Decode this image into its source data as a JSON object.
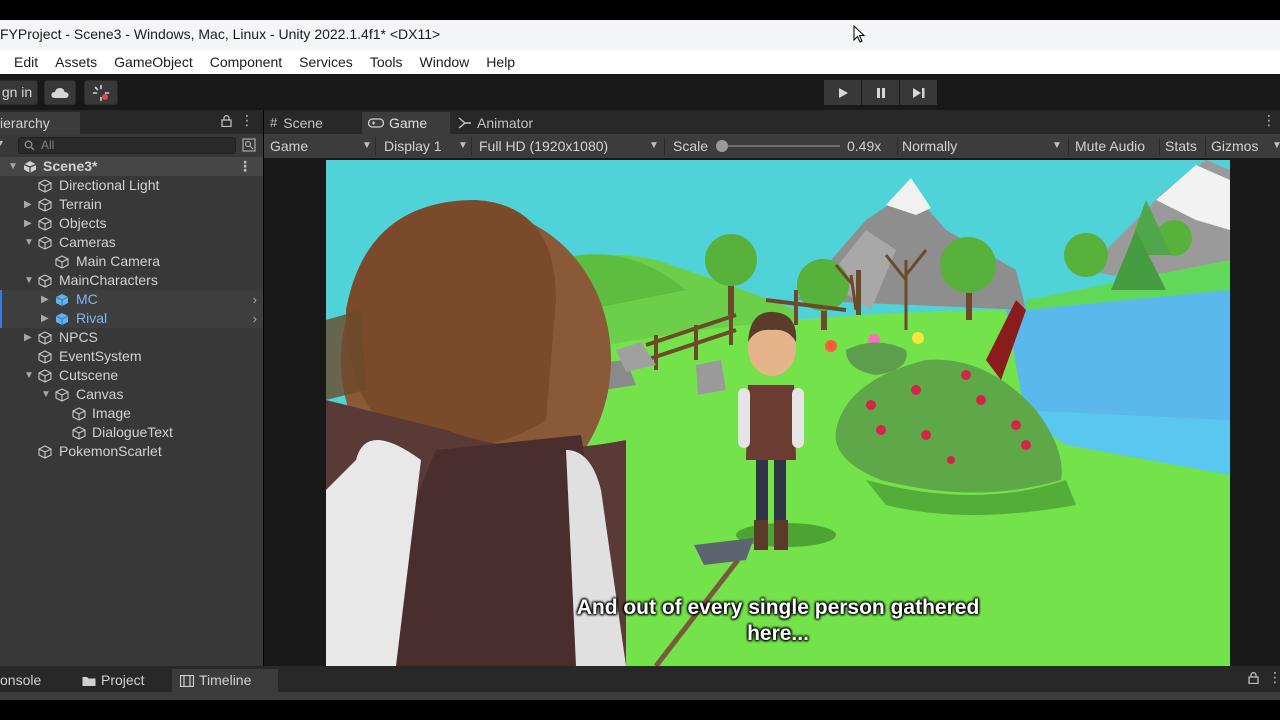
{
  "window": {
    "title": "FYProject - Scene3 - Windows, Mac, Linux - Unity 2022.1.4f1* <DX11>"
  },
  "menu": [
    "Edit",
    "Assets",
    "GameObject",
    "Component",
    "Services",
    "Tools",
    "Window",
    "Help"
  ],
  "toolbar": {
    "sign_in_label": "gn in"
  },
  "hierarchy": {
    "tab_label": "ierarchy",
    "search_placeholder": "All",
    "scene_name": "Scene3*",
    "items": [
      {
        "label": "Directional Light"
      },
      {
        "label": "Terrain"
      },
      {
        "label": "Objects"
      },
      {
        "label": "Cameras"
      },
      {
        "label": "Main Camera"
      },
      {
        "label": "MainCharacters"
      },
      {
        "label": "MC"
      },
      {
        "label": "Rival"
      },
      {
        "label": "NPCS"
      },
      {
        "label": "EventSystem"
      },
      {
        "label": "Cutscene"
      },
      {
        "label": "Canvas"
      },
      {
        "label": "Image"
      },
      {
        "label": "DialogueText"
      },
      {
        "label": "PokemonScarlet"
      }
    ]
  },
  "game_view": {
    "tabs": [
      "Scene",
      "Game",
      "Animator"
    ],
    "active_tab": "Game",
    "view_mode": "Game",
    "display": "Display 1",
    "resolution": "Full HD (1920x1080)",
    "scale_label": "Scale",
    "scale_value": "0.49x",
    "scale_fraction": 0.0,
    "play_focus": "Normally",
    "mute_audio": "Mute Audio",
    "stats": "Stats",
    "gizmos": "Gizmos",
    "subtitle_line1": "And out of every single person gathered",
    "subtitle_line2": "here..."
  },
  "bottom": {
    "tabs": [
      "onsole",
      "Project",
      "Timeline"
    ],
    "active_tab": "Timeline"
  },
  "colors": {
    "accent": "#3d7ad8",
    "prefab": "#7cb7f4",
    "sky": "#4fd3d8",
    "grass": "#6fe04a"
  }
}
